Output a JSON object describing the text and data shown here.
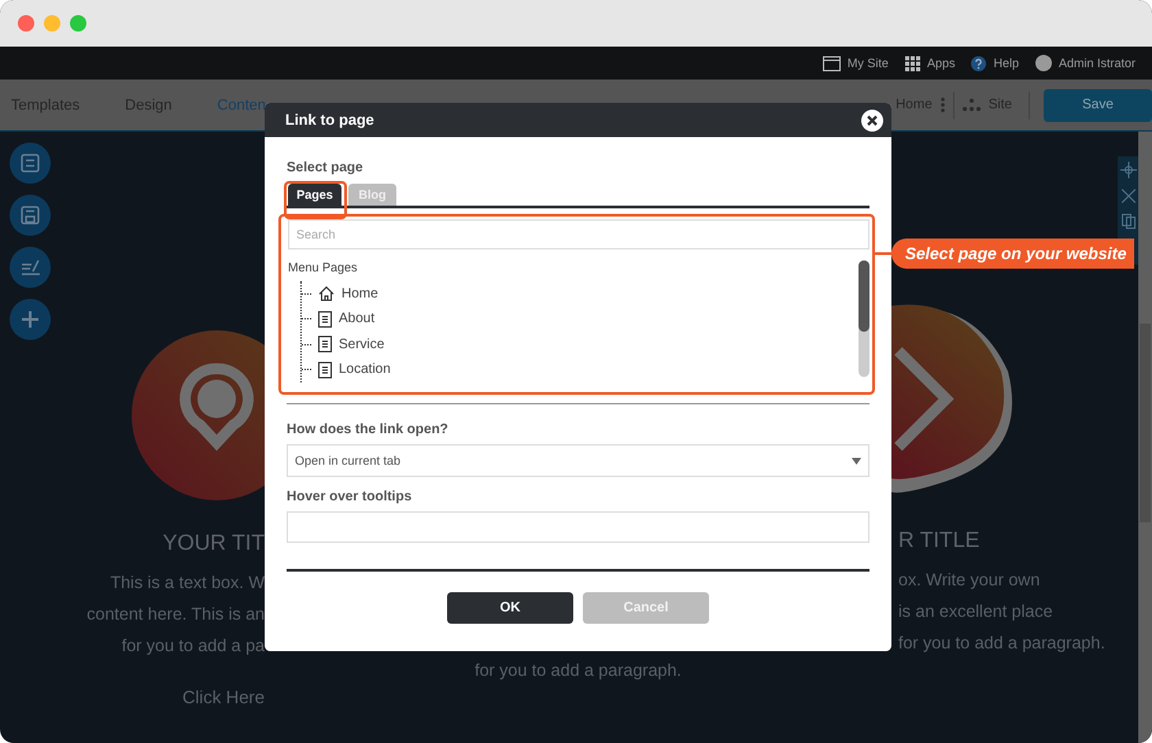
{
  "topbar": {
    "items": [
      {
        "kind": "site",
        "label": "My Site"
      },
      {
        "kind": "apps",
        "label": "Apps"
      },
      {
        "kind": "help",
        "label": "Help"
      },
      {
        "kind": "user",
        "label": "Admin Istrator"
      }
    ]
  },
  "toolbar": {
    "tabs": [
      {
        "label": "Templates",
        "selected": false
      },
      {
        "label": "Design",
        "selected": false
      },
      {
        "label": "Conten",
        "selected": true
      }
    ],
    "page": "Home",
    "site": "Site",
    "save": "Save"
  },
  "canvas": {
    "left": {
      "title": "YOUR TIT",
      "lines": [
        "This is a text box. W",
        "content here. This is an",
        "for you to add a pa"
      ],
      "link": "Click Here"
    },
    "middle": {
      "lines": [
        "for you to add a paragraph."
      ]
    },
    "right": {
      "title": "R TITLE",
      "lines": [
        "ox. Write your own",
        "is an excellent place",
        "for you to add a paragraph."
      ]
    }
  },
  "dialog": {
    "title": "Link to page",
    "section": "Select page",
    "tabs": [
      {
        "label": "Pages",
        "selected": true
      },
      {
        "label": "Blog",
        "selected": false
      }
    ],
    "search": {
      "placeholder": "Search"
    },
    "tree": {
      "label": "Menu Pages",
      "children": [
        {
          "label": "Home",
          "kind": "home"
        },
        {
          "label": "About",
          "kind": "page"
        },
        {
          "label": "Service",
          "kind": "page"
        },
        {
          "label": "Location",
          "kind": "page"
        }
      ]
    },
    "open_label": "How does the link open?",
    "open_value": "Open in current tab",
    "tooltip_label": "Hover over tooltips",
    "buttons": [
      {
        "label": "OK",
        "kind": "primary"
      },
      {
        "label": "Cancel",
        "kind": "secondary"
      }
    ]
  },
  "callout": {
    "text": "Select page on your website"
  }
}
